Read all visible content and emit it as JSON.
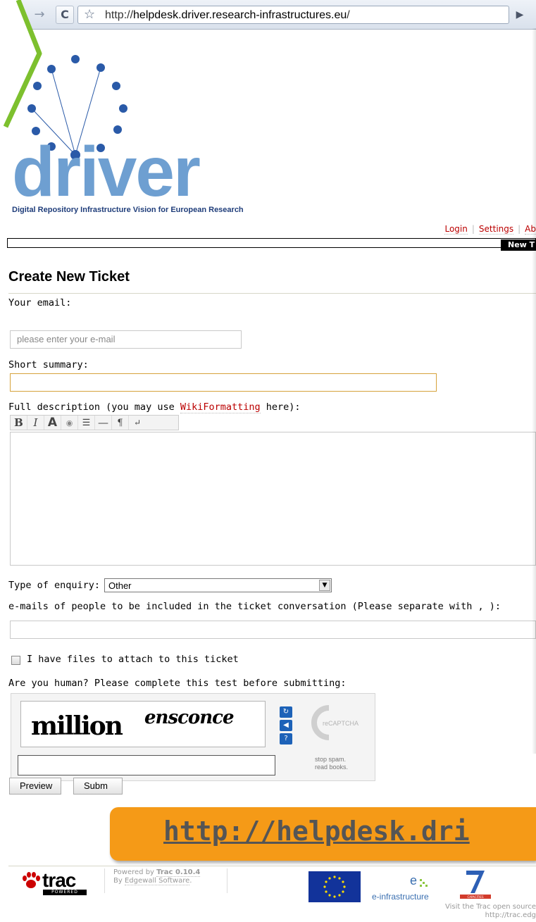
{
  "browser": {
    "back_glyph": "←",
    "forward_glyph": "→",
    "reload_glyph": "C",
    "star_glyph": "☆",
    "url_scheme": "http://",
    "url_host": "helpdesk.driver.research-infrastructures.eu",
    "url_path": "/",
    "go_glyph": "▶"
  },
  "logo": {
    "word": "driver",
    "tagline": "Digital Repository Infrastructure Vision for European Research",
    "dot_color": "#2a5aa8",
    "word_color": "#6e9fd1"
  },
  "metanav": {
    "items": [
      "Login",
      "Settings",
      "Ab"
    ]
  },
  "mainnav": {
    "active_tab": "New T"
  },
  "page": {
    "title": "Create New Ticket"
  },
  "form": {
    "email_label": "Your email:",
    "email_placeholder": "please enter your e-mail",
    "summary_label": "Short summary:",
    "summary_value": "",
    "description_label_pre": "Full description (you may use ",
    "description_link": "WikiFormatting",
    "description_label_post": " here):",
    "toolbar": [
      "B",
      "I",
      "A",
      "◉",
      "☰",
      "—",
      "¶",
      "↵"
    ],
    "type_label": "Type of enquiry:",
    "type_selected": "Other",
    "cc_label": "e-mails of people to be included in the ticket conversation (Please separate with , ):",
    "attach_label": "I have files to attach to this ticket",
    "attach_checked": false,
    "human_label": "Are you human? Please complete this test before submitting:"
  },
  "captcha": {
    "word1": "million",
    "word2": "ensconce",
    "reload_glyph": "↻",
    "audio_glyph": "◀",
    "help_glyph": "?",
    "brand": "reCAPTCHA™",
    "tagline": "stop spam.\nread books."
  },
  "buttons": {
    "preview": "Preview",
    "submit": "Subm"
  },
  "banner": {
    "text": "http://helpdesk.dri"
  },
  "footer": {
    "trac_word": "trac",
    "trac_powered": "POWERED",
    "powered_by_pre": "Powered by ",
    "powered_by_link": "Trac 0.10.4",
    "by_pre": "By ",
    "by_link": "Edgewall Software",
    "by_post": ".",
    "einfra_label": "e-infrastructure",
    "fp7_label": "CAPACITIES",
    "visit": "Visit the Trac open source\nhttp://trac.edg"
  },
  "colors": {
    "accent_link": "#bb0000",
    "banner": "#f59a17",
    "summary_border": "#d6a23b",
    "eu_blue": "#12339a",
    "recaptcha_blue": "#1d62b8"
  }
}
